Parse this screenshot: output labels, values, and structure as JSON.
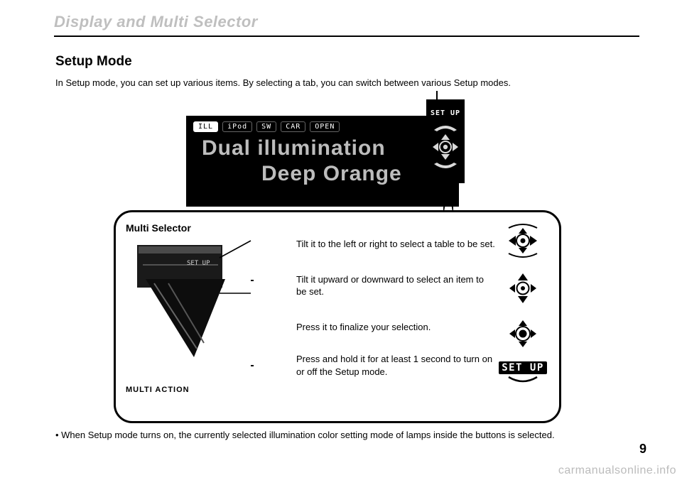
{
  "header": {
    "title": "Display and Multi Selector"
  },
  "section": {
    "title": "Setup Mode",
    "intro": "In Setup mode, you can set up various items. By selecting a tab, you can switch between various Setup modes."
  },
  "screen": {
    "tabs": {
      "ill": "ILL",
      "ipod": "iPod",
      "sw": "SW",
      "car": "CAR",
      "open": "OPEN",
      "setup": "SET UP"
    },
    "line1": "Dual illumination",
    "line2": "Deep Orange"
  },
  "callout": {
    "title": "SET UP"
  },
  "panel": {
    "multi_selector_title": "Multi Selector",
    "multi_action_title": "MULTI ACTION",
    "set_up_label": "SET UP",
    "ops": {
      "tilt_lr": "Tilt it to the left or right to select a table to be set.",
      "tilt_ud": "Tilt it upward or downward to select an item to be set.",
      "press": "Press it to finalize your selection.",
      "hold": "Press and hold it for at least 1 second to turn on or off the Setup mode."
    }
  },
  "note": "• When Setup mode turns on, the currently selected illumination color setting mode of lamps inside the buttons is selected.",
  "page_number": "9",
  "watermark": "carmanualsonline.info"
}
